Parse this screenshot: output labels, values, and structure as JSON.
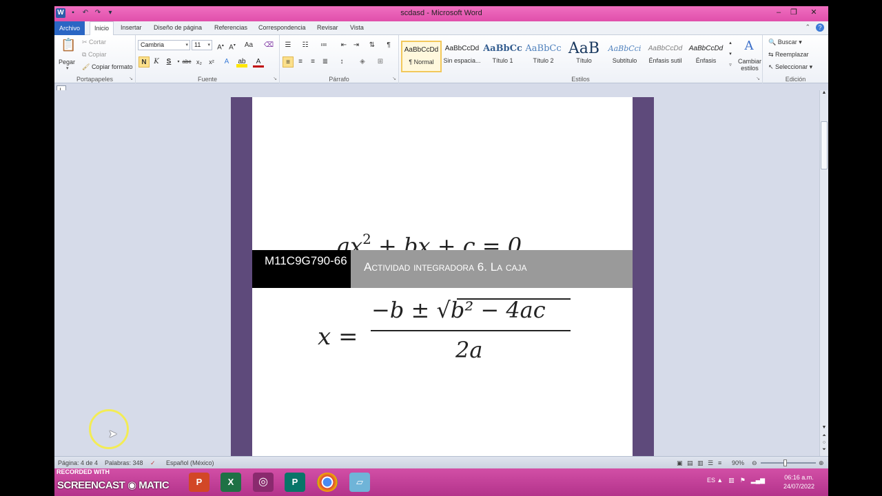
{
  "window": {
    "title": "scdasd  -  Microsoft Word",
    "minimize": "–",
    "restore": "❐",
    "close": "✕"
  },
  "tabs": {
    "archivo": "Archivo",
    "inicio": "Inicio",
    "insertar": "Insertar",
    "diseno": "Diseño de página",
    "referencias": "Referencias",
    "correspondencia": "Correspondencia",
    "revisar": "Revisar",
    "vista": "Vista"
  },
  "clipboard": {
    "pegar": "Pegar",
    "cortar": "Cortar",
    "copiar": "Copiar",
    "copiar_formato": "Copiar formato",
    "label": "Portapapeles"
  },
  "font": {
    "name": "Cambria",
    "size": "11",
    "label": "Fuente",
    "bold": "N",
    "italic": "K",
    "underline": "S",
    "strike": "abc",
    "sub": "x₂",
    "sup": "x²",
    "change_case": "Aa"
  },
  "paragraph": {
    "label": "Párrafo",
    "pilcrow": "¶"
  },
  "styles": {
    "label": "Estilos",
    "items": [
      {
        "sample": "AaBbCcDd",
        "name": "¶ Normal"
      },
      {
        "sample": "AaBbCcDd",
        "name": "Sin espacia..."
      },
      {
        "sample": "AaBbCc",
        "name": "Título 1"
      },
      {
        "sample": "AaBbCc",
        "name": "Título 2"
      },
      {
        "sample": "AaB",
        "name": "Título"
      },
      {
        "sample": "AaBbCci",
        "name": "Subtítulo"
      },
      {
        "sample": "AaBbCcDd",
        "name": "Énfasis sutil"
      },
      {
        "sample": "AaBbCcDd",
        "name": "Énfasis"
      }
    ],
    "cambiar_estilos": "Cambiar estilos"
  },
  "editing": {
    "label": "Edición",
    "buscar": "Buscar",
    "reemplazar": "Reemplazar",
    "seleccionar": "Seleccionar"
  },
  "ruler": {
    "tabstop": "L"
  },
  "document": {
    "eq1_text": "ax",
    "eq1_exp": "2",
    "eq1_rest": " + bx + c = 0",
    "banner_code": "M11C9G790-66",
    "banner_title": "Actividad integradora 6. La caja",
    "eq2_lhs": "x =",
    "eq2_num": "−b ± √b² − 4ac",
    "eq2_den": "2a"
  },
  "statusbar": {
    "page": "Página: 4 de 4",
    "words": "Palabras: 348",
    "language": "Español (México)",
    "zoom": "90%"
  },
  "taskbar": {
    "recorded_with": "RECORDED WITH",
    "screencast": "SCREENCAST",
    "matic": "MATIC",
    "lang": "ES",
    "time": "06:16 a.m.",
    "date": "24/07/2022"
  }
}
